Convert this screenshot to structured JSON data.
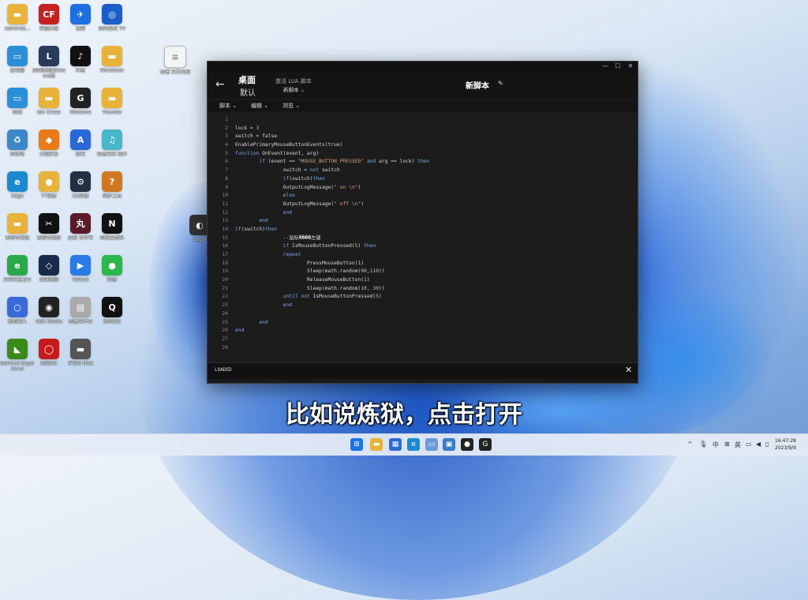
{
  "desktop": {
    "icons": [
      {
        "label": "Administ...",
        "glyph": "▬",
        "color": "#e8b33a"
      },
      {
        "label": "穿越火线",
        "glyph": "CF",
        "color": "#c62020"
      },
      {
        "label": "迅雷",
        "glyph": "✈",
        "color": "#1e6fe0"
      },
      {
        "label": "腾讯会议 TV",
        "glyph": "◎",
        "color": "#1a5fc8"
      },
      {
        "label": "此电脑",
        "glyph": "▭",
        "color": "#2a8fd6"
      },
      {
        "label": "英雄联盟WeGame版",
        "glyph": "L",
        "color": "#2a3a5a"
      },
      {
        "label": "抖音",
        "glyph": "♪",
        "color": "#111111"
      },
      {
        "label": "Wireshark",
        "glyph": "▬",
        "color": "#e8b33a"
      },
      {
        "label": "网络",
        "glyph": "▭",
        "color": "#2a8fd6"
      },
      {
        "label": "Bin Cheat",
        "glyph": "▬",
        "color": "#e8b33a"
      },
      {
        "label": "WeGame",
        "glyph": "G",
        "color": "#222222"
      },
      {
        "label": "Thunder",
        "glyph": "▬",
        "color": "#e8b33a"
      },
      {
        "label": "回收站",
        "glyph": "♻",
        "color": "#3d87c8"
      },
      {
        "label": "火绒安全",
        "glyph": "◆",
        "color": "#e87a1a"
      },
      {
        "label": "极光",
        "glyph": "A",
        "color": "#2a68d8"
      },
      {
        "label": "初音未来 软件",
        "glyph": "♫",
        "color": "#48b8c8"
      },
      {
        "label": "Edge",
        "glyph": "e",
        "color": "#1a8ad0"
      },
      {
        "label": "YY语音",
        "glyph": "●",
        "color": "#e8b33a"
      },
      {
        "label": "UU加速",
        "glyph": "⚙",
        "color": "#223044"
      },
      {
        "label": "同步工具",
        "glyph": "?",
        "color": "#d07820"
      },
      {
        "label": "剪映专业版",
        "glyph": "▬",
        "color": "#e8b33a"
      },
      {
        "label": "剪映专业版",
        "glyph": "✂",
        "color": "#111111"
      },
      {
        "label": "必剪 公众号",
        "glyph": "丸",
        "color": "#5a1a2a"
      },
      {
        "label": "网易云音乐",
        "glyph": "N",
        "color": "#111111"
      },
      {
        "label": "360安全卫士",
        "glyph": "e",
        "color": "#2aa84a"
      },
      {
        "label": "英雄联盟",
        "glyph": "◇",
        "color": "#1a2a4a"
      },
      {
        "label": "ToDesk",
        "glyph": "▶",
        "color": "#2a7ae8"
      },
      {
        "label": "微信",
        "glyph": "●",
        "color": "#2ab84a"
      },
      {
        "label": "搜狗输入",
        "glyph": "○",
        "color": "#3a6ad8"
      },
      {
        "label": "OBS Studio",
        "glyph": "◉",
        "color": "#222222"
      },
      {
        "label": "新建文件夹",
        "glyph": "▤",
        "color": "#aaaaaa"
      },
      {
        "label": "腾讯QQ",
        "glyph": "Q",
        "color": "#111111"
      },
      {
        "label": "GeForce Experience",
        "glyph": "◣",
        "color": "#3a8a1a"
      },
      {
        "label": "网易UU",
        "glyph": "◯",
        "color": "#c81a1a"
      },
      {
        "label": "罗技G HUB",
        "glyph": "▬",
        "color": "#555555"
      }
    ],
    "file_icon": {
      "label": "新建 文本文档"
    },
    "partial_icon": {
      "label": "Logi"
    }
  },
  "window": {
    "controls": {
      "min": "—",
      "max": "☐",
      "close": "✕"
    },
    "back_glyph": "←",
    "title": "桌面",
    "subtitle": "默认",
    "activate": "激活 LUA 脚本",
    "script_select": "新脚本",
    "script_name": "新脚本",
    "edit_glyph": "✎",
    "menus": [
      {
        "label": "脚本"
      },
      {
        "label": "编辑"
      },
      {
        "label": "浏览"
      }
    ],
    "status": "LOADED",
    "status_close": "✕"
  },
  "editor": {
    "line_numbers": [
      "1",
      "2",
      "3",
      "4",
      "5",
      "6",
      "7",
      "8",
      "9",
      "10",
      "11",
      "12",
      "13",
      "14",
      "15",
      "16",
      "17",
      "18",
      "19",
      "20",
      "21",
      "22",
      "23",
      "24",
      "25",
      "26",
      "27",
      "28"
    ],
    "lines": [
      {
        "text": ""
      },
      {
        "text": "lock = 3"
      },
      {
        "text": "switch = false"
      },
      {
        "text": "EnablePrimaryMouseButtonEvents(true)"
      },
      {
        "text": "function OnEvent(event, arg)"
      },
      {
        "text": "        if (event == \"MOUSE_BUTTON_PRESSED\" and arg == lock) then"
      },
      {
        "text": "                switch = not switch"
      },
      {
        "text": "                if(switch)then"
      },
      {
        "text": "                OutputLogMessage(\" on \\n\")"
      },
      {
        "text": "                else"
      },
      {
        "text": "                OutputLogMessage(\" off \\n\")"
      },
      {
        "text": "                end"
      },
      {
        "text": "        end"
      },
      {
        "text": "if(switch)then"
      },
      {
        "text": "                --鼠标����左键"
      },
      {
        "text": "                if IsMouseButtonPressed(5) then"
      },
      {
        "text": "                repeat"
      },
      {
        "text": "                        PressMouseButton(1)"
      },
      {
        "text": "                        Sleep(math.random(90,110))"
      },
      {
        "text": "                        ReleaseMouseButton(1)"
      },
      {
        "text": "                        Sleep(math.random(10, 30))"
      },
      {
        "text": "                until not IsMouseButtonPressed(5)"
      },
      {
        "text": "                end"
      },
      {
        "text": ""
      },
      {
        "text": "        end"
      },
      {
        "text": "end"
      },
      {
        "text": ""
      },
      {
        "text": ""
      }
    ]
  },
  "subtitle": "比如说炼狱，点击打开",
  "taskbar": {
    "icons": [
      {
        "glyph": "⊞",
        "color": "#1a73e8"
      },
      {
        "glyph": "▬",
        "color": "#e8b33a"
      },
      {
        "glyph": "▦",
        "color": "#2a6ad8"
      },
      {
        "glyph": "e",
        "color": "#1a8ad0"
      },
      {
        "glyph": "▭",
        "color": "#6a9ad8"
      },
      {
        "glyph": "▣",
        "color": "#3a7ac8"
      },
      {
        "glyph": "●",
        "color": "#222222"
      },
      {
        "glyph": "G",
        "color": "#222222"
      }
    ],
    "tray": {
      "chevron": "^",
      "mic": "🎙",
      "ime": "中",
      "grid": "⊞",
      "lang": "英",
      "display": "▭",
      "speaker": "◀",
      "battery": "▯"
    },
    "time": "16:47:28",
    "date": "2023/9/9"
  }
}
